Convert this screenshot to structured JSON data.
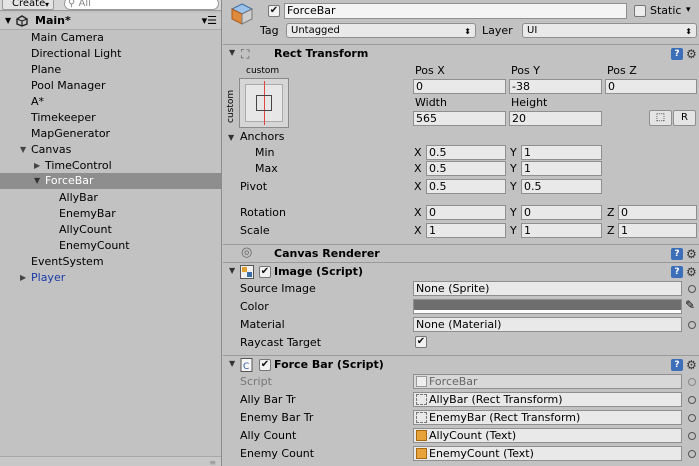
{
  "hierarchy": {
    "create_label": "Create",
    "search_placeholder": "All",
    "scene_name": "Main*",
    "items": [
      {
        "label": "Main Camera"
      },
      {
        "label": "Directional Light"
      },
      {
        "label": "Plane"
      },
      {
        "label": "Pool Manager"
      },
      {
        "label": "A*"
      },
      {
        "label": "Timekeeper"
      },
      {
        "label": "MapGenerator"
      },
      {
        "label": "Canvas"
      },
      {
        "label": "TimeControl"
      },
      {
        "label": "ForceBar"
      },
      {
        "label": "AllyBar"
      },
      {
        "label": "EnemyBar"
      },
      {
        "label": "AllyCount"
      },
      {
        "label": "EnemyCount"
      },
      {
        "label": "EventSystem"
      },
      {
        "label": "Player"
      }
    ]
  },
  "inspector": {
    "object_name": "ForceBar",
    "static_label": "Static",
    "tag_label": "Tag",
    "tag_value": "Untagged",
    "layer_label": "Layer",
    "layer_value": "UI",
    "rect_transform": {
      "title": "Rect Transform",
      "anchor_preset_top": "custom",
      "anchor_preset_side": "custom",
      "pos_x_label": "Pos X",
      "pos_y_label": "Pos Y",
      "pos_z_label": "Pos Z",
      "pos_x": "0",
      "pos_y": "-38",
      "pos_z": "0",
      "width_label": "Width",
      "height_label": "Height",
      "width": "565",
      "height": "20",
      "raw_button": "R",
      "anchors_label": "Anchors",
      "min_label": "Min",
      "min_x": "0.5",
      "min_y": "1",
      "max_label": "Max",
      "max_x": "0.5",
      "max_y": "1",
      "pivot_label": "Pivot",
      "pivot_x": "0.5",
      "pivot_y": "0.5",
      "rotation_label": "Rotation",
      "rot_x": "0",
      "rot_y": "0",
      "rot_z": "0",
      "scale_label": "Scale",
      "scale_x": "1",
      "scale_y": "1",
      "scale_z": "1",
      "x": "X",
      "y": "Y",
      "z": "Z"
    },
    "canvas_renderer": {
      "title": "Canvas Renderer"
    },
    "image": {
      "title": "Image (Script)",
      "source_image_label": "Source Image",
      "source_image_value": "None (Sprite)",
      "color_label": "Color",
      "color_value": "#6e6e6e",
      "material_label": "Material",
      "material_value": "None (Material)",
      "raycast_label": "Raycast Target"
    },
    "force_bar": {
      "title": "Force Bar (Script)",
      "script_label": "Script",
      "script_value": "ForceBar",
      "ally_bar_tr_label": "Ally Bar Tr",
      "ally_bar_tr_value": "AllyBar (Rect Transform)",
      "enemy_bar_tr_label": "Enemy Bar Tr",
      "enemy_bar_tr_value": "EnemyBar (Rect Transform)",
      "ally_count_label": "Ally Count",
      "ally_count_value": "AllyCount (Text)",
      "enemy_count_label": "Enemy Count",
      "enemy_count_value": "EnemyCount (Text)"
    }
  }
}
